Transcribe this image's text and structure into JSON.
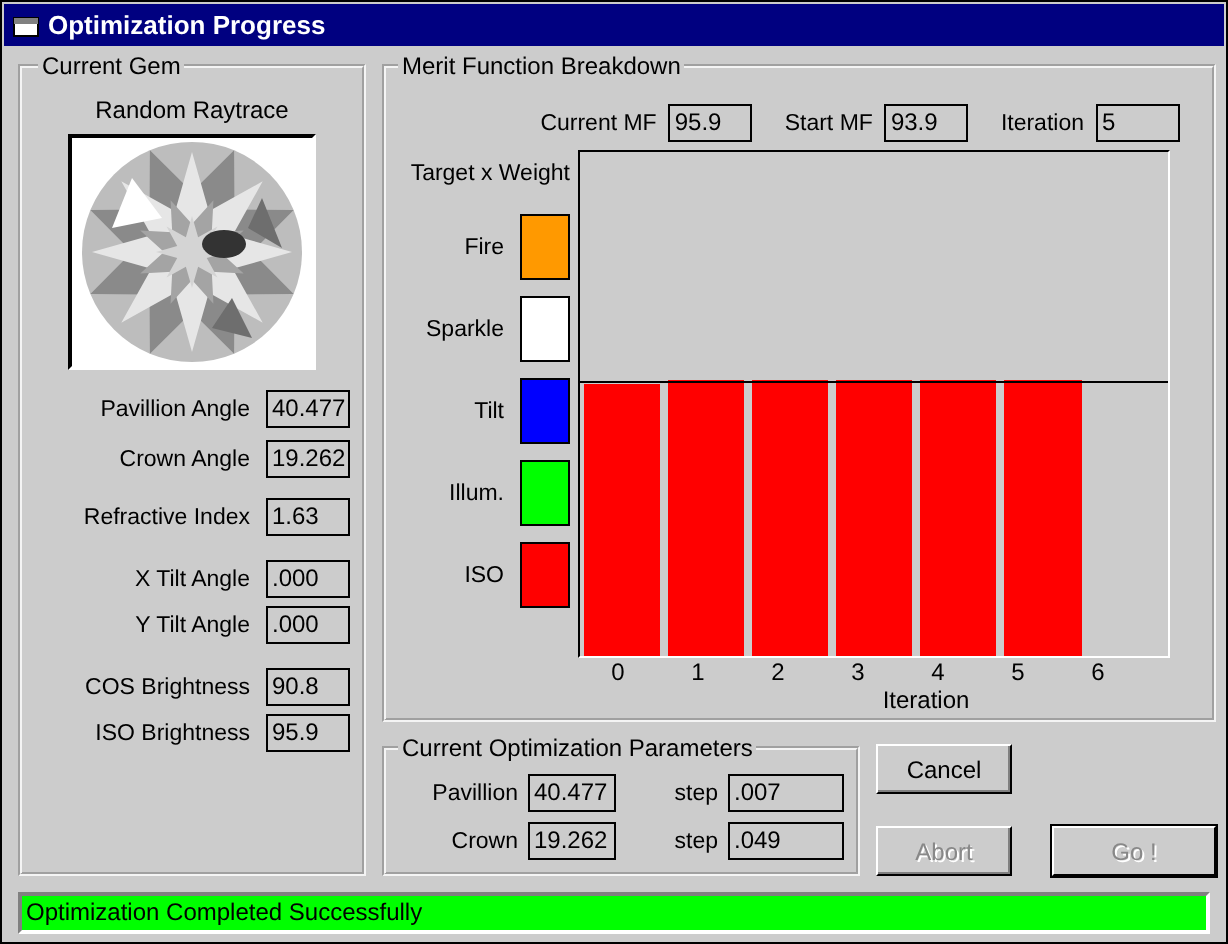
{
  "window": {
    "title": "Optimization Progress"
  },
  "current_gem": {
    "title": "Current Gem",
    "image_caption": "Random Raytrace",
    "fields": [
      {
        "label": "Pavillion Angle",
        "value": "40.477"
      },
      {
        "label": "Crown Angle",
        "value": "19.262"
      },
      {
        "label": "Refractive Index",
        "value": "1.63"
      },
      {
        "label": "X Tilt Angle",
        "value": ".000"
      },
      {
        "label": "Y Tilt Angle",
        "value": ".000"
      },
      {
        "label": "COS Brightness",
        "value": "90.8"
      },
      {
        "label": "ISO Brightness",
        "value": "95.9"
      }
    ]
  },
  "merit": {
    "title": "Merit Function Breakdown",
    "stats": [
      {
        "label": "Current MF",
        "value": "95.9"
      },
      {
        "label": "Start MF",
        "value": "93.9"
      },
      {
        "label": "Iteration",
        "value": "5"
      }
    ],
    "legend_title": "Target x Weight",
    "legend": [
      {
        "label": "Fire",
        "color": "#ff9900"
      },
      {
        "label": "Sparkle",
        "color": "#ffffff"
      },
      {
        "label": "Tilt",
        "color": "#0000ff"
      },
      {
        "label": "Illum.",
        "color": "#00ff00"
      },
      {
        "label": "ISO",
        "color": "#ff0000"
      }
    ],
    "x_labels": [
      "0",
      "1",
      "2",
      "3",
      "4",
      "5",
      "6"
    ],
    "x_title": "Iteration"
  },
  "parameters": {
    "title": "Current Optimization Parameters",
    "rows": [
      {
        "label": "Pavillion",
        "value": "40.477",
        "step_label": "step",
        "step": ".007"
      },
      {
        "label": "Crown",
        "value": "19.262",
        "step_label": "step",
        "step": ".049"
      }
    ]
  },
  "buttons": [
    {
      "label": "Cancel",
      "disabled": false,
      "default": false
    },
    {
      "label": "Abort",
      "disabled": true,
      "default": false
    },
    {
      "label": "Go !",
      "disabled": true,
      "default": true
    }
  ],
  "status_bar": {
    "text": "Optimization Completed Successfully"
  }
}
